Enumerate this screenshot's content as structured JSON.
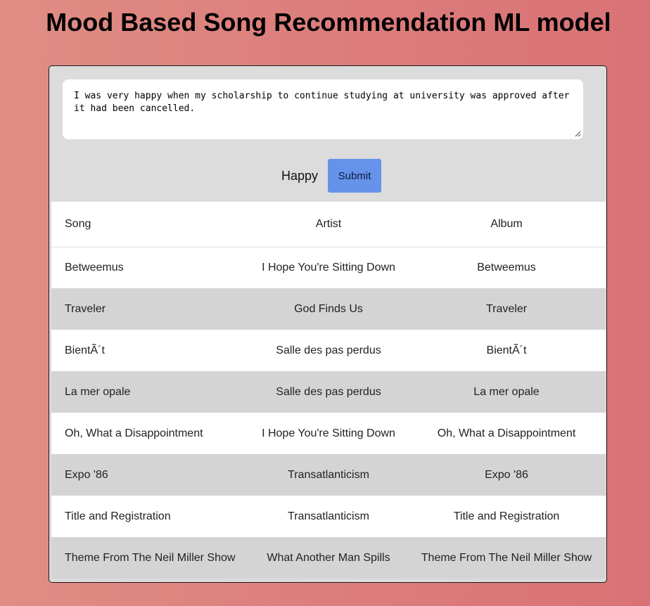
{
  "page": {
    "title": "Mood Based Song Recommendation ML model"
  },
  "input": {
    "text": "I was very happy when my scholarship to continue studying at university was approved after it had been cancelled.",
    "placeholder": ""
  },
  "prediction": {
    "mood": "Happy"
  },
  "controls": {
    "submit_label": "Submit",
    "accent_color": "#6593ea"
  },
  "table": {
    "headers": {
      "song": "Song",
      "artist": "Artist",
      "album": "Album"
    },
    "rows": [
      {
        "song": "Betweemus",
        "artist": "I Hope You're Sitting Down",
        "album": "Betweemus"
      },
      {
        "song": "Traveler",
        "artist": "God Finds Us",
        "album": "Traveler"
      },
      {
        "song": "BientÃ´t",
        "artist": "Salle des pas perdus",
        "album": "BientÃ´t"
      },
      {
        "song": "La mer opale",
        "artist": "Salle des pas perdus",
        "album": "La mer opale"
      },
      {
        "song": "Oh, What a Disappointment",
        "artist": "I Hope You're Sitting Down",
        "album": "Oh, What a Disappointment"
      },
      {
        "song": "Expo '86",
        "artist": "Transatlanticism",
        "album": "Expo '86"
      },
      {
        "song": "Title and Registration",
        "artist": "Transatlanticism",
        "album": "Title and Registration"
      },
      {
        "song": "Theme From The Neil Miller Show",
        "artist": "What Another Man Spills",
        "album": "Theme From The Neil Miller Show"
      }
    ]
  }
}
